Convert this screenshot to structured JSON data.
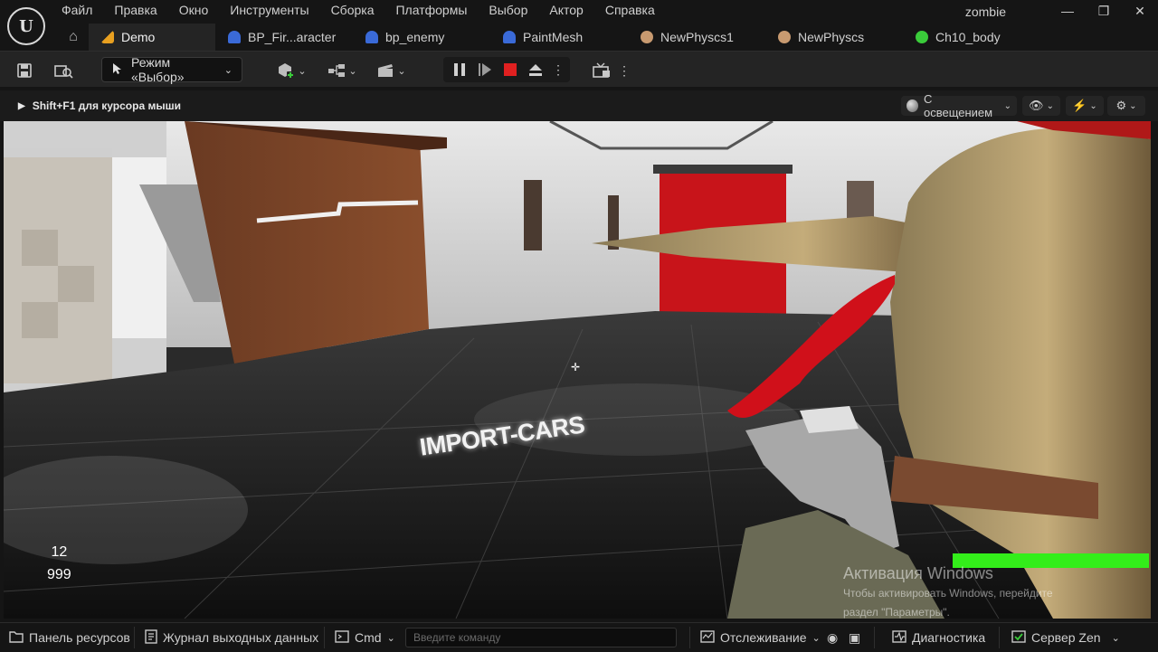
{
  "app": {
    "project_name": "zombie",
    "menu": [
      "Файл",
      "Правка",
      "Окно",
      "Инструменты",
      "Сборка",
      "Платформы",
      "Выбор",
      "Актор",
      "Справка"
    ],
    "logo": "U"
  },
  "window_controls": {
    "minimize": "—",
    "maximize": "❐",
    "close": "✕"
  },
  "tabs": [
    {
      "label": "Demo",
      "icon": "level-icon",
      "color": "#e8a020"
    },
    {
      "label": "BP_Fir...aracter",
      "icon": "blueprint-icon",
      "color": "#3a6ad8"
    },
    {
      "label": "bp_enemy",
      "icon": "blueprint-icon",
      "color": "#3a6ad8"
    },
    {
      "label": "PaintMesh",
      "icon": "blueprint-icon",
      "color": "#3a6ad8"
    },
    {
      "label": "NewPhyscs1",
      "icon": "physics-asset-icon",
      "color": "#c89a70"
    },
    {
      "label": "NewPhyscs",
      "icon": "physics-asset-icon",
      "color": "#c89a70"
    },
    {
      "label": "Ch10_body",
      "icon": "skeletal-mesh-icon",
      "color": "#3acb3a"
    }
  ],
  "toolbar": {
    "mode_label": "Режим «Выбор»",
    "pause_icon": "pause-icon",
    "skip_icon": "frame-skip-icon",
    "stop_icon": "stop-icon",
    "eject_icon": "eject-icon",
    "stop_color": "#e02020"
  },
  "viewport": {
    "hint": "Shift+F1 для курсора мыши",
    "lighting_mode": "С освещением",
    "sign_text": "IMPORT-CARS",
    "crosshair": "✛"
  },
  "hud": {
    "ammo_clip": "12",
    "ammo_total": "999",
    "health_fraction": 1.0,
    "health_color": "#33ee1a"
  },
  "watermark": {
    "title": "Активация Windows",
    "line1": "Чтобы активировать Windows, перейдите",
    "line2": "раздел \"Параметры\"."
  },
  "statusbar": {
    "content_browser": "Панель ресурсов",
    "output_log": "Журнал выходных данных",
    "cmd_label": "Cmd",
    "cmd_placeholder": "Введите команду",
    "trace": "Отслеживание",
    "diagnostics": "Диагностика",
    "zen_server": "Сервер Zen"
  }
}
